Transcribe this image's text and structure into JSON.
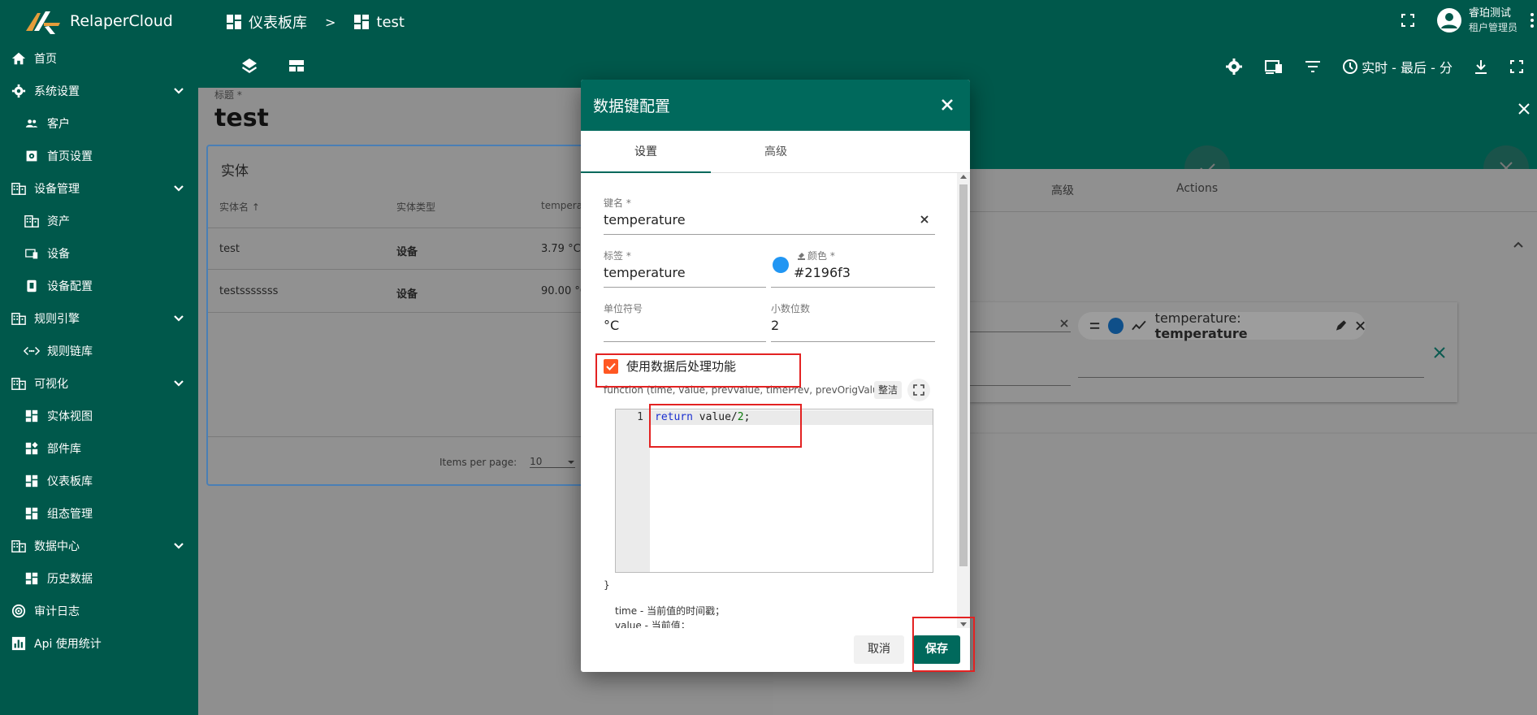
{
  "brand": {
    "name": "RelaperCloud"
  },
  "sidebar": {
    "items": [
      {
        "label": "首页",
        "level": "top",
        "icon": "home-icon"
      },
      {
        "label": "系统设置",
        "level": "top",
        "icon": "gear-icon",
        "expandable": true
      },
      {
        "label": "客户",
        "level": "sub",
        "icon": "people-icon"
      },
      {
        "label": "首页设置",
        "level": "sub",
        "icon": "settings-box-icon"
      },
      {
        "label": "设备管理",
        "level": "top",
        "icon": "building-icon",
        "expandable": true
      },
      {
        "label": "资产",
        "level": "sub",
        "icon": "building-icon"
      },
      {
        "label": "设备",
        "level": "sub",
        "icon": "device-icon"
      },
      {
        "label": "设备配置",
        "level": "sub",
        "icon": "device-profile-icon"
      },
      {
        "label": "规则引擎",
        "level": "top",
        "icon": "building-icon",
        "expandable": true
      },
      {
        "label": "规则链库",
        "level": "sub",
        "icon": "code-arrows-icon"
      },
      {
        "label": "可视化",
        "level": "top",
        "icon": "building-icon",
        "expandable": true
      },
      {
        "label": "实体视图",
        "level": "sub",
        "icon": "dashboard-icon"
      },
      {
        "label": "部件库",
        "level": "sub",
        "icon": "widgets-icon"
      },
      {
        "label": "仪表板库",
        "level": "sub",
        "icon": "dashboard-icon"
      },
      {
        "label": "组态管理",
        "level": "sub",
        "icon": "dashboard-icon"
      },
      {
        "label": "数据中心",
        "level": "top",
        "icon": "building-icon",
        "expandable": true
      },
      {
        "label": "历史数据",
        "level": "sub",
        "icon": "dashboard-icon"
      },
      {
        "label": "审计日志",
        "level": "top",
        "icon": "audit-icon"
      },
      {
        "label": "Api 使用统计",
        "level": "top",
        "icon": "chart-icon"
      }
    ]
  },
  "header": {
    "breadcrumb_root": "仪表板库",
    "breadcrumb_sep": ">",
    "breadcrumb_current": "test",
    "user_name": "睿珀测试",
    "user_role": "租户管理员",
    "timewindow_label": "实时 - 最后 - 分"
  },
  "dashboard": {
    "title_label": "标题 *",
    "title": "test",
    "widget": {
      "title": "实体",
      "columns": [
        "实体名 ↑",
        "实体类型",
        "temperature"
      ],
      "rows": [
        [
          "test",
          "设备",
          "3.79 °C"
        ],
        [
          "testsssssss",
          "设备",
          "90.00 °C"
        ]
      ],
      "items_per_page_label": "Items per page:",
      "items_per_page_value": "10"
    }
  },
  "right_panel": {
    "tabs": [
      "高级",
      "Actions"
    ],
    "chip_label": "temperature: ",
    "chip_label_bold": "temperature"
  },
  "dialog": {
    "title": "数据键配置",
    "tabs": [
      "设置",
      "高级"
    ],
    "active_tab": 0,
    "key_name_label": "键名 *",
    "key_name_value": "temperature",
    "label_label": "标签 *",
    "label_value": "temperature",
    "color_label": "颜色 *",
    "color_value": "#2196f3",
    "color_display": "#2196f3",
    "unit_label": "单位符号",
    "unit_value": "°C",
    "decimals_label": "小数位数",
    "decimals_value": "2",
    "postprocess_label": "使用数据后处理功能",
    "postprocess_checked": true,
    "function_signature": "function (time, value, prevValue, timePrev, prevOrigValue) {",
    "tidy_label": "整洁",
    "code_line_no": "1",
    "code_keyword": "return",
    "code_rest": " value/",
    "code_number": "2",
    "code_end": ";",
    "closing_brace": "}",
    "help_line1": "time - 当前值的时间戳；",
    "help_line2": "value - 当前值；",
    "cancel_label": "取消",
    "save_label": "保存"
  },
  "colors": {
    "primary": "#00584b",
    "dialog_header": "#00695c",
    "checkbox": "#ff5722",
    "annotation": "#e32222"
  }
}
